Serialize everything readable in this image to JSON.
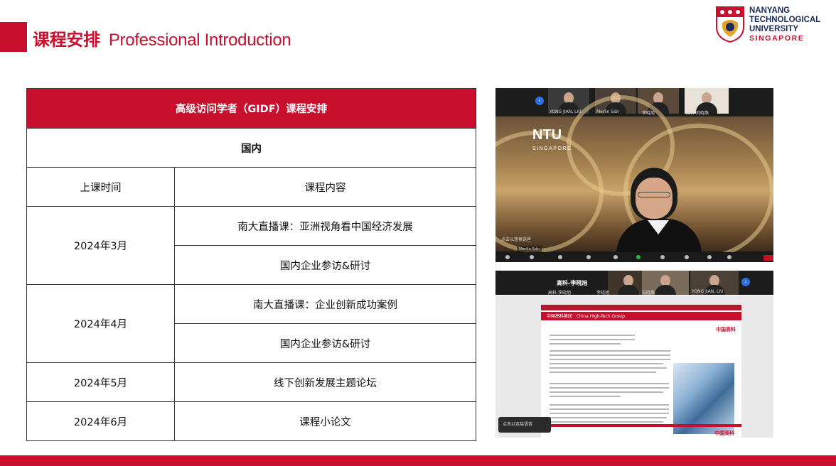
{
  "header": {
    "title_cn": "课程安排",
    "title_en": "Professional Introduction"
  },
  "logo": {
    "line1": "NANYANG",
    "line2": "TECHNOLOGICAL",
    "line3": "UNIVERSITY",
    "line4": "SINGAPORE"
  },
  "colors": {
    "accent": "#c8102e",
    "logo_navy": "#1a2a5c"
  },
  "schedule": {
    "heading": "高级访问学者（GIDF）课程安排",
    "subheading": "国内",
    "columns": [
      "上课时间",
      "课程内容"
    ],
    "groups": [
      {
        "date": "2024年3月",
        "items": [
          "南大直播课：亚洲视角看中国经济发展",
          "国内企业参访&研讨"
        ]
      },
      {
        "date": "2024年4月",
        "items": [
          "南大直播课：企业创新成功案例",
          "国内企业参访&研讨"
        ]
      },
      {
        "date": "2024年5月",
        "items": [
          "线下创新发展主题论坛"
        ]
      },
      {
        "date": "2024年6月",
        "items": [
          "课程小论文"
        ]
      }
    ]
  },
  "screenshot1": {
    "participants": [
      "YONG JIAN, LIU",
      "Merlin Sdn",
      "李晓旭",
      "高科·刘晓燕"
    ],
    "ntu_logo": "NTU",
    "ntu_sub": "SINGAPORE",
    "speaker_label": "点击以连接语音",
    "name_chip": "Merlin Sdn"
  },
  "screenshot2": {
    "header": "高科-李晓旭",
    "participants": [
      "高科-李晓旭",
      "李晓旭",
      "白晓燕",
      "YONG JIAN, LIU"
    ],
    "doc_band_title": "中国高科集团 · China High-Tech Group",
    "doc_logo": "中国高科",
    "doc_footer_logo": "中国高科",
    "popup": "点击以连接语音"
  }
}
